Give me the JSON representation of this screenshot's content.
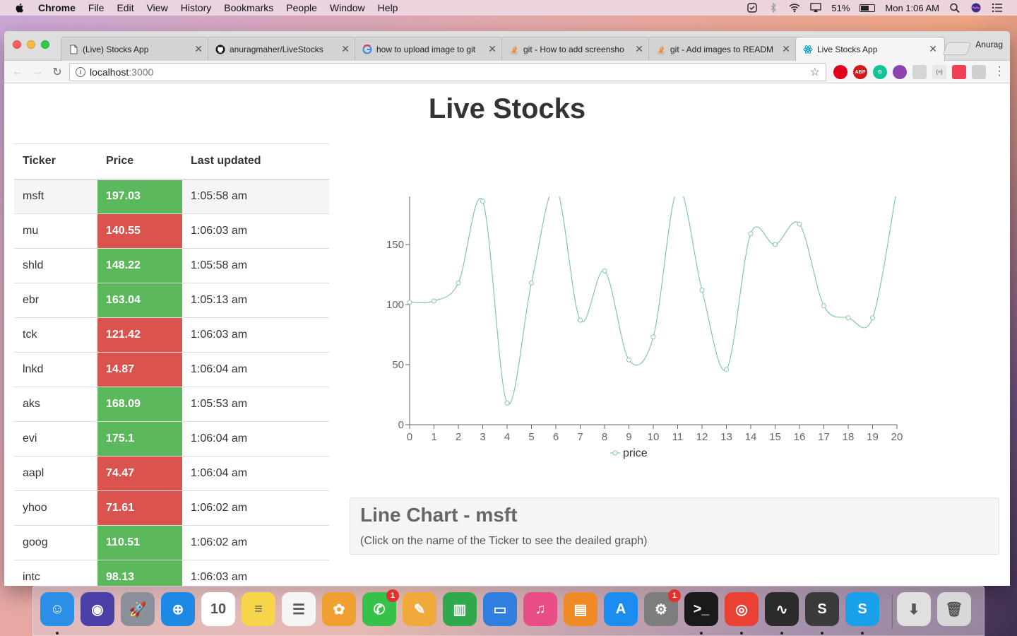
{
  "menubar": {
    "app_name": "Chrome",
    "items": [
      "File",
      "Edit",
      "View",
      "History",
      "Bookmarks",
      "People",
      "Window",
      "Help"
    ],
    "battery": "51%",
    "clock": "Mon 1:06 AM"
  },
  "browser": {
    "tabs": [
      {
        "title": "(Live) Stocks App",
        "icon": "document-icon"
      },
      {
        "title": "anuragmaher/LiveStocks",
        "icon": "github-icon"
      },
      {
        "title": "how to upload image to git",
        "icon": "google-icon"
      },
      {
        "title": "git - How to add screensho",
        "icon": "stackoverflow-icon"
      },
      {
        "title": "git - Add images to READM",
        "icon": "stackoverflow-icon"
      },
      {
        "title": "Live Stocks App",
        "icon": "react-icon"
      }
    ],
    "profile": "Anurag",
    "address": {
      "host": "localhost",
      "port": ":3000"
    },
    "extensions": [
      {
        "name": "opera-icon",
        "color": "#e0001b",
        "label": ""
      },
      {
        "name": "adblock-icon",
        "color": "#d11b1b",
        "label": "ABP"
      },
      {
        "name": "grammarly-icon",
        "color": "#15c39a",
        "label": "G"
      },
      {
        "name": "colorpick-icon",
        "color": "#8e44ad",
        "label": ""
      },
      {
        "name": "extension-icon",
        "color": "#d5d5d5",
        "label": ""
      },
      {
        "name": "json-icon",
        "color": "#e8e8e8",
        "label": "{≡}"
      },
      {
        "name": "pocket-icon",
        "color": "#ef4056",
        "label": ""
      },
      {
        "name": "qr-icon",
        "color": "#cfcfcf",
        "label": ""
      }
    ]
  },
  "page": {
    "title": "Live Stocks",
    "table": {
      "headers": [
        "Ticker",
        "Price",
        "Last updated"
      ],
      "rows": [
        {
          "ticker": "msft",
          "price": "197.03",
          "updated": "1:05:58 am",
          "trend": "up"
        },
        {
          "ticker": "mu",
          "price": "140.55",
          "updated": "1:06:03 am",
          "trend": "down"
        },
        {
          "ticker": "shld",
          "price": "148.22",
          "updated": "1:05:58 am",
          "trend": "up"
        },
        {
          "ticker": "ebr",
          "price": "163.04",
          "updated": "1:05:13 am",
          "trend": "up"
        },
        {
          "ticker": "tck",
          "price": "121.42",
          "updated": "1:06:03 am",
          "trend": "down"
        },
        {
          "ticker": "lnkd",
          "price": "14.87",
          "updated": "1:06:04 am",
          "trend": "down"
        },
        {
          "ticker": "aks",
          "price": "168.09",
          "updated": "1:05:53 am",
          "trend": "up"
        },
        {
          "ticker": "evi",
          "price": "175.1",
          "updated": "1:06:04 am",
          "trend": "up"
        },
        {
          "ticker": "aapl",
          "price": "74.47",
          "updated": "1:06:04 am",
          "trend": "down"
        },
        {
          "ticker": "yhoo",
          "price": "71.61",
          "updated": "1:06:02 am",
          "trend": "down"
        },
        {
          "ticker": "goog",
          "price": "110.51",
          "updated": "1:06:02 am",
          "trend": "up"
        },
        {
          "ticker": "intc",
          "price": "98.13",
          "updated": "1:06:03 am",
          "trend": "up"
        }
      ]
    },
    "panel": {
      "title": "Line Chart - msft",
      "hint": "(Click on the name of the Ticker to see the deailed graph)"
    },
    "colors": {
      "up": "#5cb85c",
      "down": "#d9534f",
      "line": "#82ca9d"
    }
  },
  "chart_data": {
    "type": "line",
    "x": [
      0,
      1,
      2,
      3,
      4,
      5,
      6,
      7,
      8,
      9,
      10,
      11,
      12,
      13,
      14,
      15,
      16,
      17,
      18,
      19,
      20
    ],
    "series": [
      {
        "name": "price",
        "values": [
          102,
          103,
          118,
          186,
          18,
          118,
          197,
          87,
          128,
          54,
          73,
          196,
          112,
          46,
          159,
          150,
          167,
          99,
          89,
          89,
          197
        ]
      }
    ],
    "yticks": [
      0,
      50,
      100,
      150,
      200
    ],
    "ylim": [
      0,
      200
    ],
    "xlim": [
      0,
      20
    ],
    "grid": false,
    "legend": "bottom"
  },
  "dock": {
    "apps": [
      {
        "name": "finder-icon",
        "color": "#2b8fe6",
        "glyph": "☺",
        "running": true
      },
      {
        "name": "siri-icon",
        "color": "#4b3fa8",
        "glyph": "◉",
        "running": false
      },
      {
        "name": "launchpad-icon",
        "color": "#8a8f99",
        "glyph": "🚀",
        "running": false
      },
      {
        "name": "safari-icon",
        "color": "#1e88e5",
        "glyph": "⊕",
        "running": false
      },
      {
        "name": "calendar-icon",
        "color": "#ffffff",
        "glyph": "10",
        "running": false
      },
      {
        "name": "notes-icon",
        "color": "#f7d54a",
        "glyph": "≡",
        "running": false
      },
      {
        "name": "reminders-icon",
        "color": "#f5f5f5",
        "glyph": "☰",
        "running": false
      },
      {
        "name": "photos-icon",
        "color": "#f0a030",
        "glyph": "✿",
        "running": false
      },
      {
        "name": "facetime-icon",
        "color": "#36c24a",
        "glyph": "✆",
        "running": false,
        "badge": "1"
      },
      {
        "name": "pages-icon",
        "color": "#f2a93b",
        "glyph": "✎",
        "running": false
      },
      {
        "name": "numbers-icon",
        "color": "#2fa94b",
        "glyph": "▥",
        "running": false
      },
      {
        "name": "keynote-icon",
        "color": "#2f7ee0",
        "glyph": "▭",
        "running": false
      },
      {
        "name": "itunes-icon",
        "color": "#e84d88",
        "glyph": "♫",
        "running": false
      },
      {
        "name": "ibooks-icon",
        "color": "#f08a24",
        "glyph": "▤",
        "running": false
      },
      {
        "name": "appstore-icon",
        "color": "#1b8df0",
        "glyph": "A",
        "running": false
      },
      {
        "name": "system-preferences-icon",
        "color": "#7d7d7d",
        "glyph": "⚙",
        "running": false,
        "badge": "1"
      },
      {
        "name": "terminal-icon",
        "color": "#1a1a1a",
        "glyph": ">_",
        "running": true
      },
      {
        "name": "chrome-icon",
        "color": "#e94235",
        "glyph": "◎",
        "running": true
      },
      {
        "name": "activity-monitor-icon",
        "color": "#2b2b2b",
        "glyph": "∿",
        "running": true
      },
      {
        "name": "sublime-text-icon",
        "color": "#3a3a3a",
        "glyph": "S",
        "running": true
      },
      {
        "name": "skype-icon",
        "color": "#1aa0e8",
        "glyph": "S",
        "running": true
      },
      {
        "name": "downloads-icon",
        "color": "#e0e0e0",
        "glyph": "⬇",
        "running": false
      },
      {
        "name": "trash-icon",
        "color": "#d8d8d8",
        "glyph": "🗑",
        "running": false
      }
    ]
  }
}
